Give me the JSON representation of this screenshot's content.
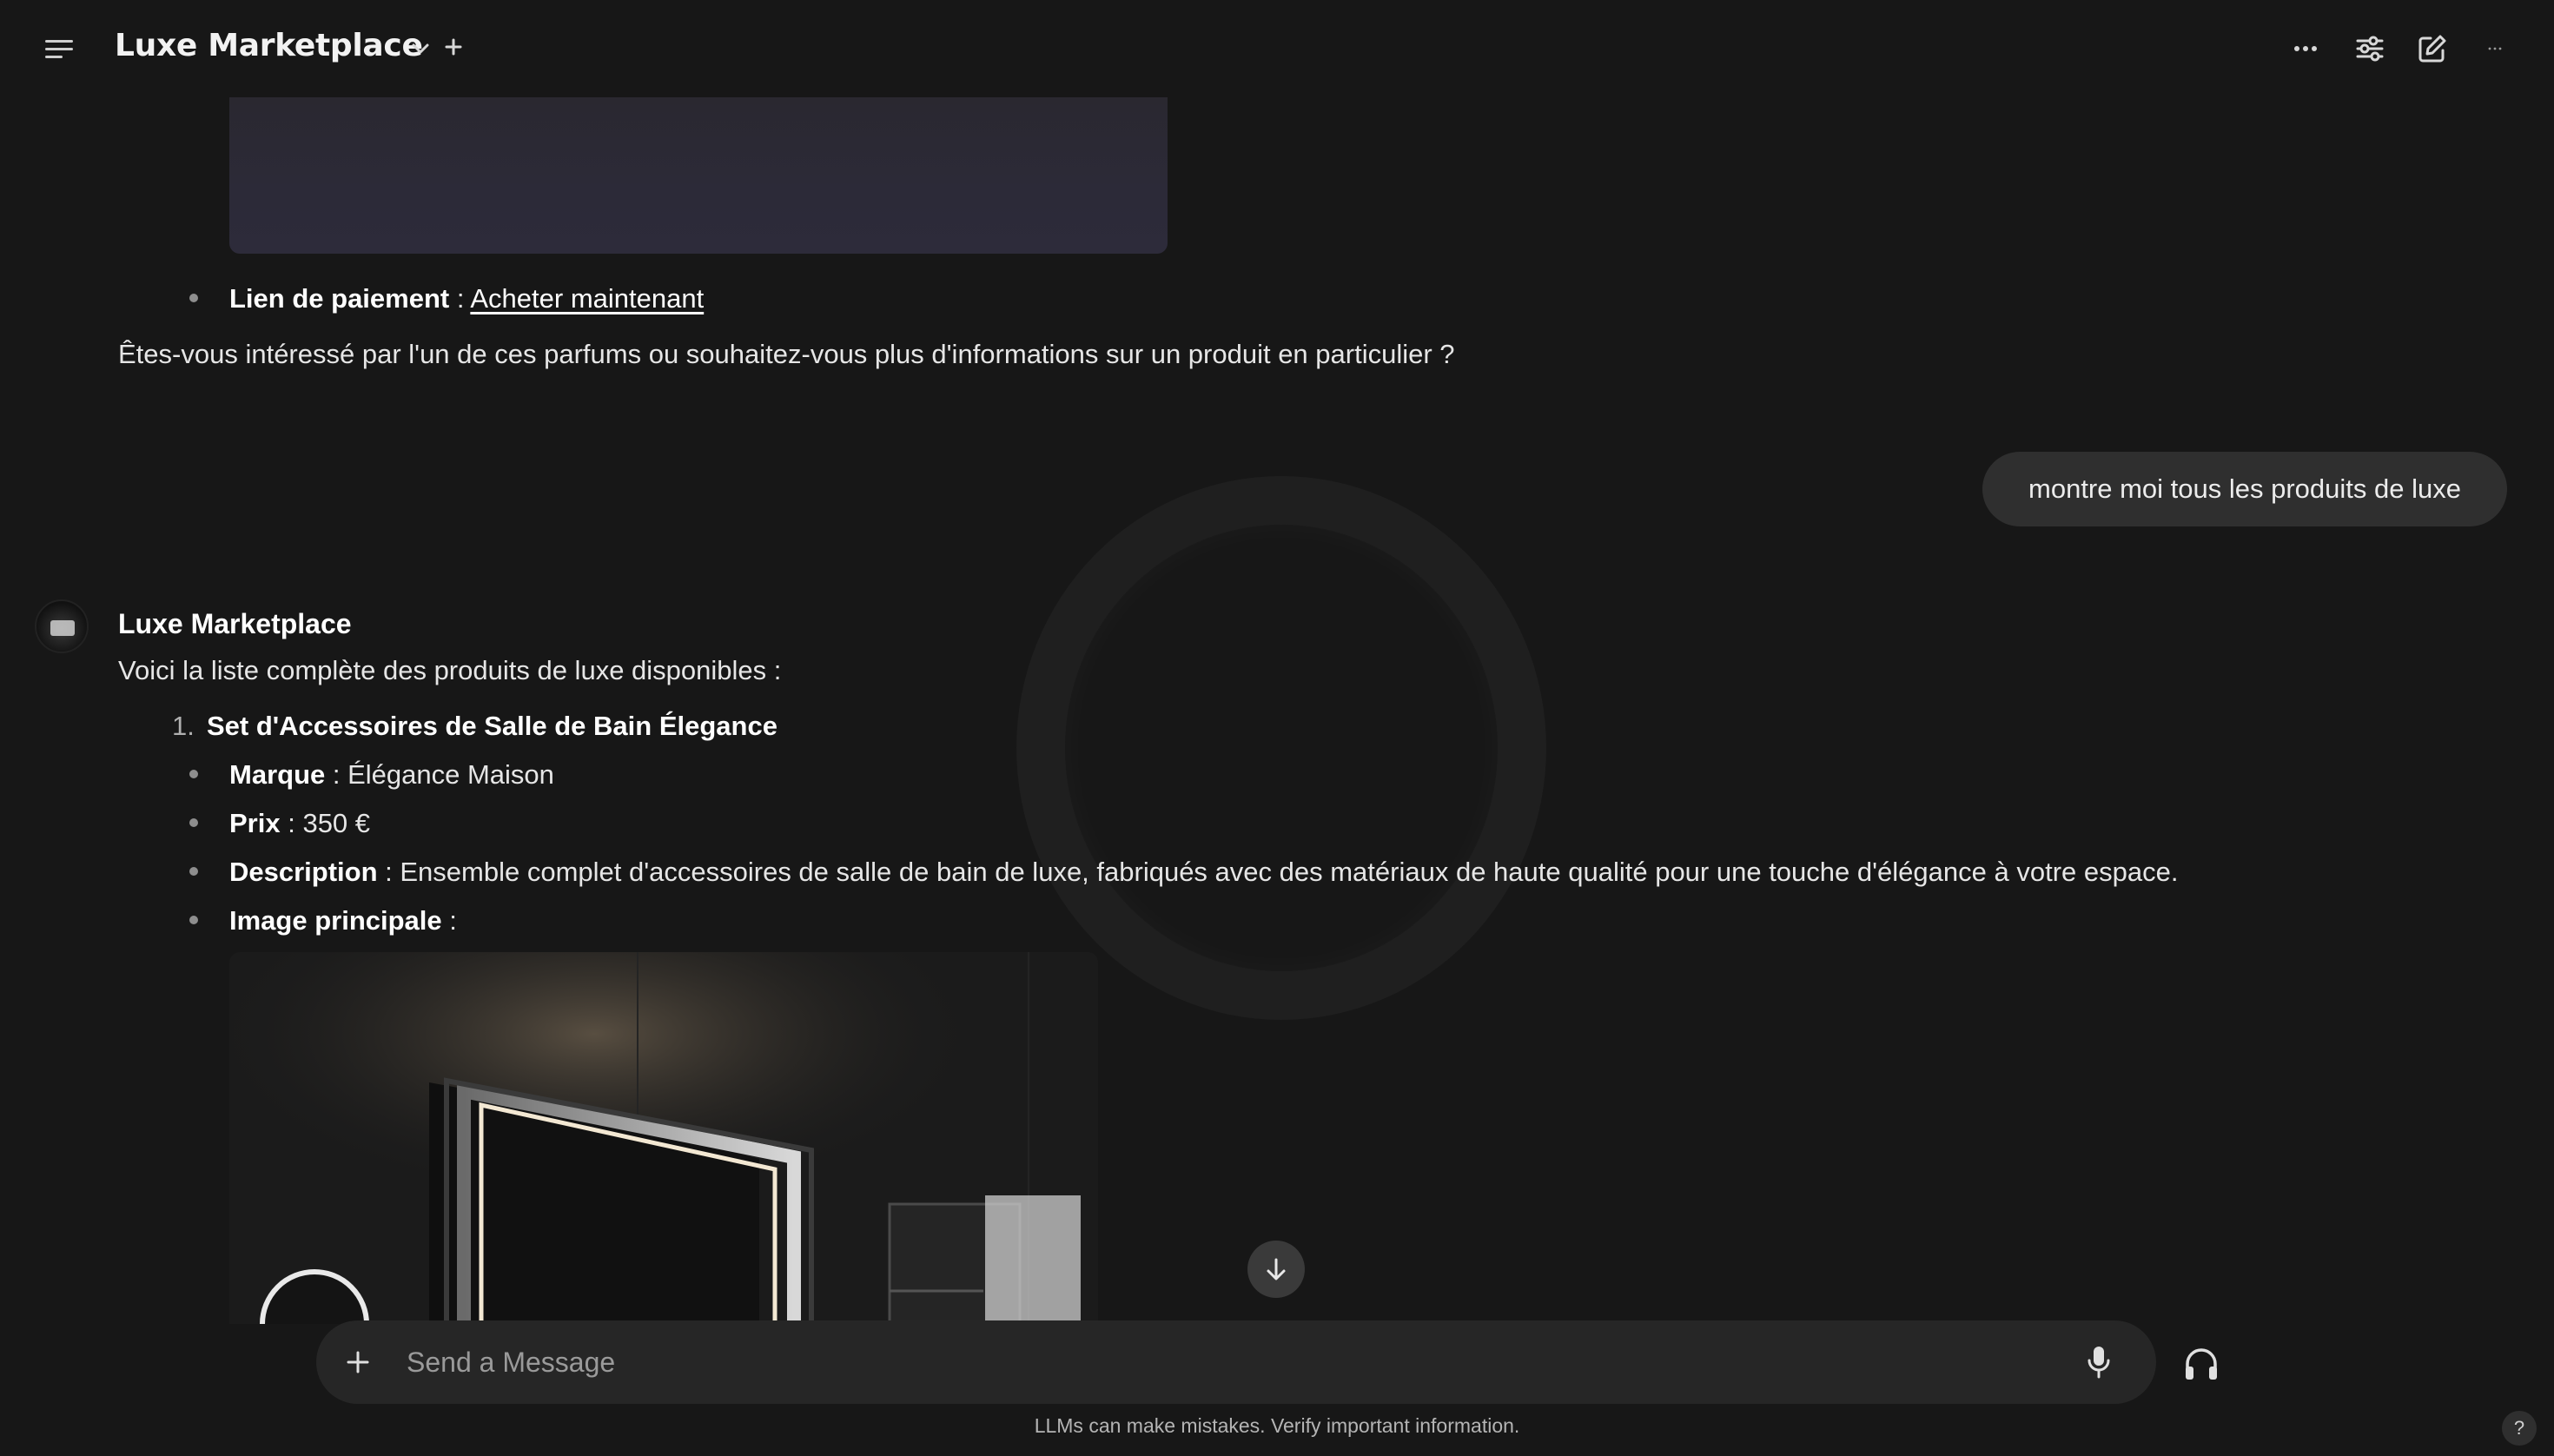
{
  "header": {
    "title": "Luxe Marketplace",
    "icons": [
      "menu-icon",
      "chevron-down-icon",
      "plus-icon",
      "more-horizontal-icon",
      "sliders-icon",
      "edit-icon",
      "ellipsis-icon"
    ]
  },
  "messages": {
    "prev": {
      "payment_label": "Lien de paiement",
      "payment_sep": " : ",
      "payment_link": "Acheter maintenant",
      "question": "Êtes-vous intéressé par l'un de ces parfums ou souhaitez-vous plus d'informations sur un produit en particulier ?"
    },
    "user": {
      "text": "montre moi tous les produits de luxe"
    },
    "bot": {
      "name": "Luxe Marketplace",
      "intro": "Voici la liste complète des produits de luxe disponibles :",
      "product": {
        "number": "1.",
        "name": "Set d'Accessoires de Salle de Bain Élegance",
        "brand_label": "Marque",
        "brand_value": " : Élégance Maison",
        "price_label": "Prix",
        "price_value": " : 350 €",
        "desc_label": "Description",
        "desc_value": " : Ensemble complet d'accessoires de salle de bain de luxe, fabriqués avec des matériaux de haute qualité pour une touche d'élégance à votre espace.",
        "image_label": "Image principale",
        "image_value": " :"
      }
    }
  },
  "input": {
    "placeholder": "Send a Message"
  },
  "footer": {
    "disclaimer": "LLMs can make mistakes. Verify important information.",
    "help": "?"
  },
  "colors": {
    "background": "#171717",
    "input_bg": "#262626",
    "bubble_bg": "#2f2f2f",
    "text": "#ececec"
  }
}
